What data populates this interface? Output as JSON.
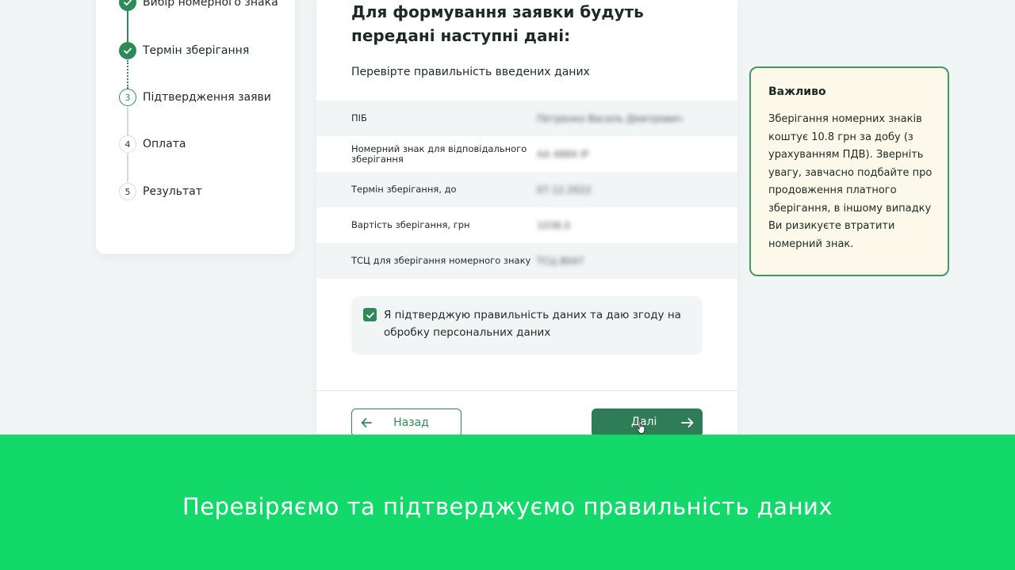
{
  "stepper": {
    "steps": [
      {
        "number": "",
        "label": "Вибір номерного знака",
        "state": "done"
      },
      {
        "number": "",
        "label": "Термін зберігання",
        "state": "done"
      },
      {
        "number": "3",
        "label": "Підтвердження заяви",
        "state": "active"
      },
      {
        "number": "4",
        "label": "Оплата",
        "state": "todo"
      },
      {
        "number": "5",
        "label": "Результат",
        "state": "todo"
      }
    ]
  },
  "main": {
    "title": "Для формування заявки будуть передані наступні дані:",
    "subtitle": "Перевірте правильність введених даних",
    "rows": [
      {
        "label": "ПІБ",
        "value": "Петренко Василь Дмитрович"
      },
      {
        "label": "Номерний знак для відповідального зберігання",
        "value": "АА 4884 ІР"
      },
      {
        "label": "Термін зберігання, до",
        "value": "07.12.2022"
      },
      {
        "label": "Вартість зберігання, грн",
        "value": "1038.0"
      },
      {
        "label": "ТСЦ для зберігання номерного знаку",
        "value": "ТСЦ 8047"
      }
    ],
    "consent_text": "Я підтверджую правильність даних та даю згоду на обробку персональних даних",
    "back_label": "Назад",
    "next_label": "Далі"
  },
  "info": {
    "title": "Важливо",
    "text": "Зберігання номерних знаків коштує 10.8 грн за добу (з урахуванням ПДВ). Зверніть увагу, завчасно подбайте про продовження платного зберігання, в іншому випадку Ви ризикуєте втратити номерний знак."
  },
  "caption": "Перевіряємо та підтверджуємо правильність даних",
  "colors": {
    "accent": "#2e8b57",
    "banner": "#13d96a",
    "info_background": "#fcf8ea"
  },
  "icons": {
    "done_step": "check-icon",
    "back": "arrow-left-icon",
    "next": "arrow-right-icon",
    "consent": "checkbox-checked-icon",
    "cursor": "pointer-hand-icon"
  }
}
